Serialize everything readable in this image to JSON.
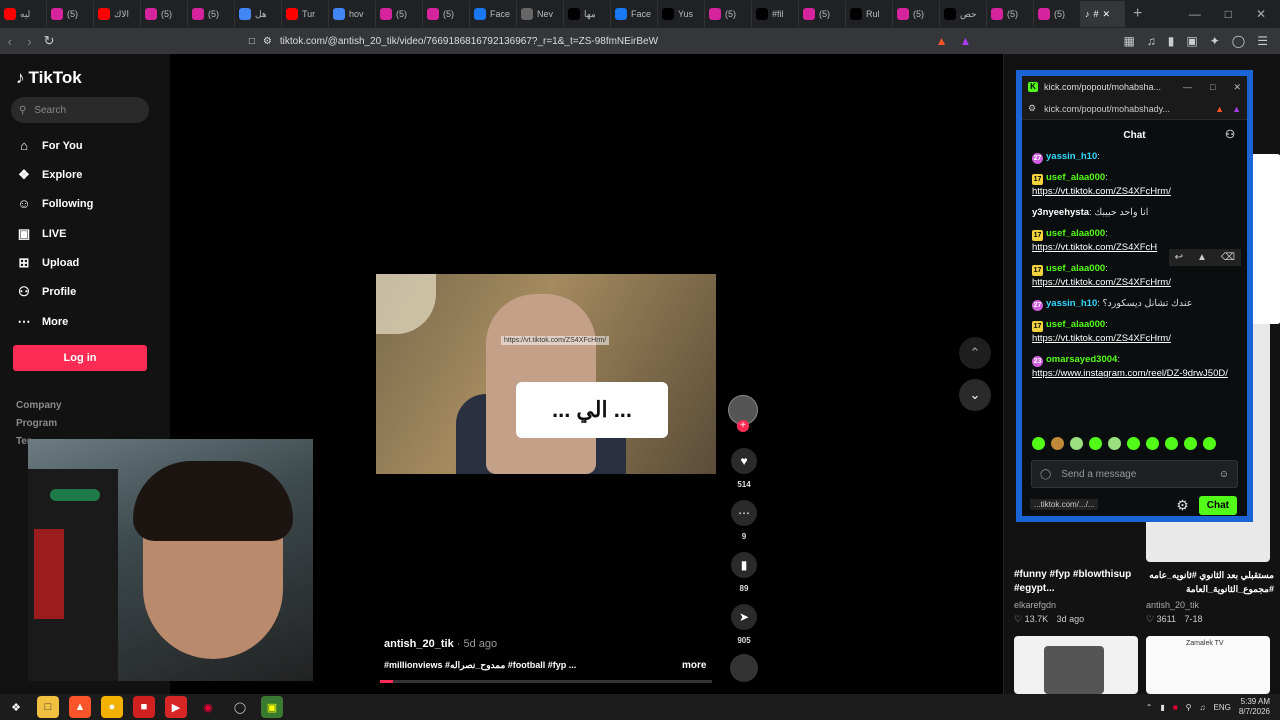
{
  "browser": {
    "tabs": [
      {
        "label": "ليه",
        "icon": "youtube-icon",
        "color": "#ff0000"
      },
      {
        "label": "(5)",
        "icon": "instagram-icon",
        "color": "#d6249f"
      },
      {
        "label": "الاك",
        "icon": "youtube-icon",
        "color": "#ff0000"
      },
      {
        "label": "(5)",
        "icon": "instagram-icon",
        "color": "#d6249f"
      },
      {
        "label": "(5)",
        "icon": "instagram-icon",
        "color": "#d6249f"
      },
      {
        "label": "هل",
        "icon": "google-icon",
        "color": "#4285f4"
      },
      {
        "label": "Tur",
        "icon": "youtube-icon",
        "color": "#ff0000"
      },
      {
        "label": "hov",
        "icon": "google-icon",
        "color": "#4285f4"
      },
      {
        "label": "(5)",
        "icon": "instagram-icon",
        "color": "#d6249f"
      },
      {
        "label": "(5)",
        "icon": "instagram-icon",
        "color": "#d6249f"
      },
      {
        "label": "Face",
        "icon": "facebook-icon",
        "color": "#1877f2"
      },
      {
        "label": "Nev",
        "icon": "shield-icon",
        "color": "#666666"
      },
      {
        "label": "مها",
        "icon": "tiktok-icon",
        "color": "#000000"
      },
      {
        "label": "Face",
        "icon": "facebook-icon",
        "color": "#1877f2"
      },
      {
        "label": "Yus",
        "icon": "tiktok-icon",
        "color": "#000000"
      },
      {
        "label": "(5)",
        "icon": "instagram-icon",
        "color": "#d6249f"
      },
      {
        "label": "#fil",
        "icon": "tiktok-icon",
        "color": "#000000"
      },
      {
        "label": "(5)",
        "icon": "instagram-icon",
        "color": "#d6249f"
      },
      {
        "label": "Rul",
        "icon": "tiktok-icon",
        "color": "#000000"
      },
      {
        "label": "(5)",
        "icon": "instagram-icon",
        "color": "#d6249f"
      },
      {
        "label": "حص",
        "icon": "tiktok-icon",
        "color": "#000000"
      },
      {
        "label": "(5)",
        "icon": "instagram-icon",
        "color": "#d6249f"
      },
      {
        "label": "(5)",
        "icon": "instagram-icon",
        "color": "#d6249f"
      }
    ],
    "active_tab_label": "#",
    "url": "tiktok.com/@antish_20_tik/video/7669186816792136967?_r=1&_t=ZS-98fmNEirBeW"
  },
  "tiktok": {
    "logo": "TikTok",
    "search_placeholder": "Search",
    "nav": [
      "For You",
      "Explore",
      "Following",
      "LIVE",
      "Upload",
      "Profile",
      "More"
    ],
    "login": "Log in",
    "footer": [
      "Company",
      "Program",
      "Ter"
    ],
    "video": {
      "overlay_url": "https://vt.tiktok.com/ZS4XFcHrm/",
      "caption": "... الي ...",
      "author": "antish_20_tik",
      "ago": "· 5d ago",
      "description": "#millionviews #ممدوح_نصراله #football #fyp ...",
      "more": "more",
      "progress": 0.04
    },
    "actions": {
      "likes": "514",
      "comments": "9",
      "saves": "89",
      "shares": "905"
    }
  },
  "feed": {
    "items": [
      {
        "title": "#funny #fyp #blowthisup #egypt...",
        "author": "elkarefgdn",
        "views": "13.7K",
        "ago": "3d ago"
      },
      {
        "title": "مستقبلي بعد الثانوي #ثانويه_عامه #مجموع_الثانوية_العامة",
        "author": "antish_20_tik",
        "views": "3611",
        "ago": "7-18"
      }
    ],
    "zamalek_label": "Zamalek TV"
  },
  "kick": {
    "window_title": "kick.com/popout/mohabsha...",
    "url": "kick.com/popout/mohabshady...",
    "chat_title": "Chat",
    "messages": [
      {
        "user": "yassin_h10",
        "badge": "pink",
        "badge_text": "27",
        "text": "",
        "link": "",
        "color": "cyan"
      },
      {
        "user": "usef_alaa000",
        "badge": "gold",
        "badge_text": "17",
        "text": "",
        "link": "https://vt.tiktok.com/ZS4XFcHrm/",
        "color": "green"
      },
      {
        "user": "y3nyeehysta",
        "badge": "",
        "badge_text": "",
        "text": "انا واحد حبيبك",
        "link": "",
        "color": "white"
      },
      {
        "user": "usef_alaa000",
        "badge": "gold",
        "badge_text": "17",
        "text": "",
        "link": "https://vt.tiktok.com/ZS4XFcH",
        "color": "green"
      },
      {
        "user": "usef_alaa000",
        "badge": "gold",
        "badge_text": "17",
        "text": "",
        "link": "https://vt.tiktok.com/ZS4XFcHrm/",
        "color": "green"
      },
      {
        "user": "yassin_h10",
        "badge": "pink",
        "badge_text": "27",
        "text": "عندك تشانل ديسكورد؟",
        "link": "",
        "color": "cyan"
      },
      {
        "user": "usef_alaa000",
        "badge": "gold",
        "badge_text": "17",
        "text": "",
        "link": "https://vt.tiktok.com/ZS4XFcHrm/",
        "color": "green"
      },
      {
        "user": "omarsayed3004",
        "badge": "pink",
        "badge_text": "23",
        "text": "",
        "link": "https://www.instagram.com/reel/DZ-9drwJ50D/",
        "color": "green"
      }
    ],
    "input_placeholder": "Send a message",
    "chat_button": "Chat",
    "status_url": "...tiktok.com/.../..."
  },
  "taskbar": {
    "lang": "ENG",
    "time": "5:39 AM",
    "date": "8/7/2026"
  }
}
